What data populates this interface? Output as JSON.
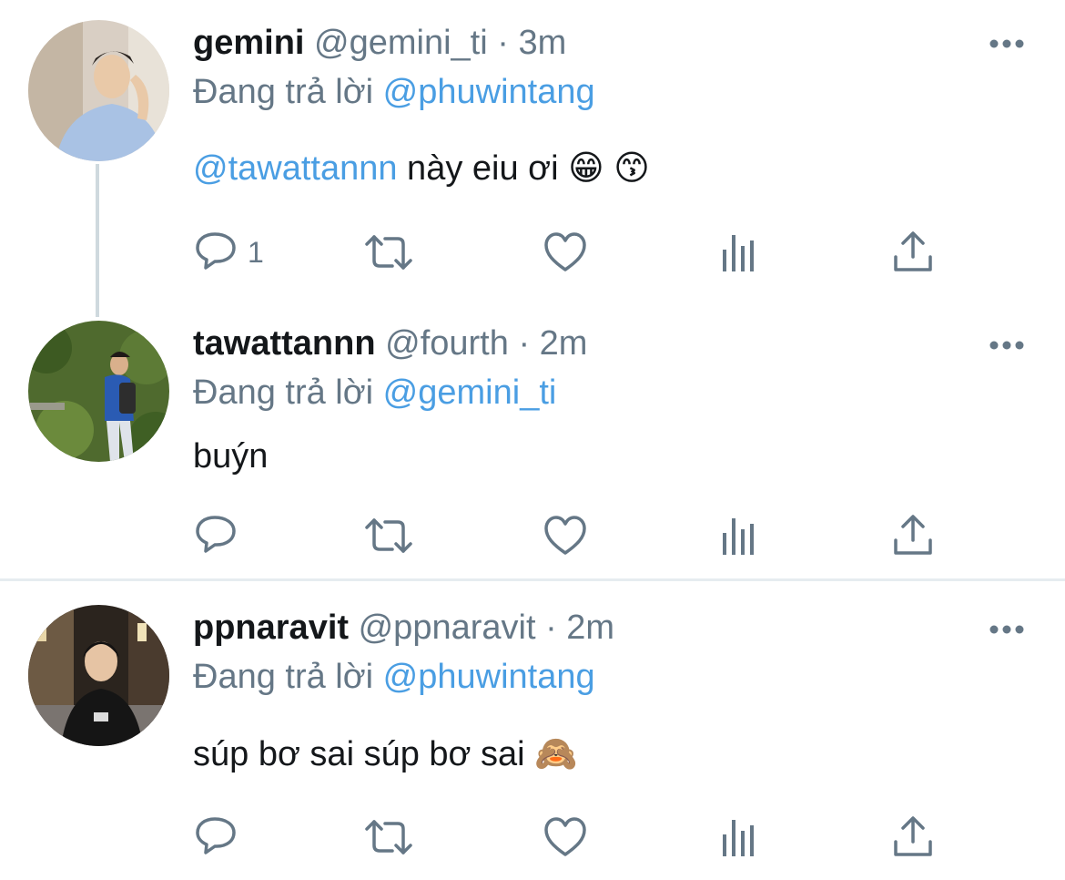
{
  "tweets": [
    {
      "name": "gemini",
      "handle": "@gemini_ti",
      "separator": "·",
      "time": "3m",
      "reply_prefix": "Đang trả lời",
      "reply_to": "@phuwintang",
      "body_mention": "@tawattannn",
      "body_text": " này eiu ơi ",
      "emojis": [
        "😁",
        "😙"
      ],
      "reply_count": "1"
    },
    {
      "name": "tawattannn",
      "handle": "@fourth",
      "separator": "·",
      "time": "2m",
      "reply_prefix": "Đang trả lời",
      "reply_to": "@gemini_ti",
      "body_text": "buýn",
      "reply_count": ""
    },
    {
      "name": "ppnaravit",
      "handle": "@ppnaravit",
      "separator": "·",
      "time": "2m",
      "reply_prefix": "Đang trả lời",
      "reply_to": "@phuwintang",
      "body_text": "súp bơ sai súp bơ sai ",
      "emojis": [
        "🙈"
      ],
      "reply_count": ""
    }
  ],
  "icons": [
    "more-icon",
    "reply-icon",
    "retweet-icon",
    "like-icon",
    "analytics-icon",
    "share-icon"
  ],
  "colors": {
    "mention": "#4a9ee3",
    "secondary_text": "#657786",
    "icon": "#657786",
    "divider": "#e6ecf0"
  }
}
